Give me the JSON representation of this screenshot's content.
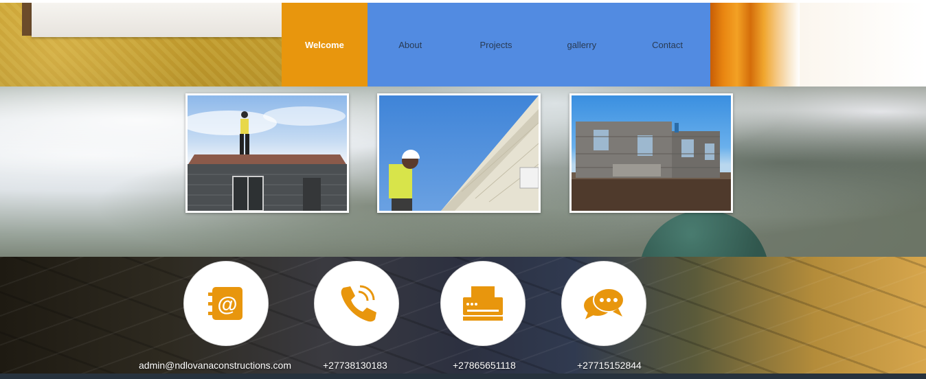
{
  "nav": {
    "items": [
      {
        "label": "Welcome",
        "active": true
      },
      {
        "label": "About"
      },
      {
        "label": "Projects"
      },
      {
        "label": "gallerry"
      },
      {
        "label": "Contact"
      }
    ],
    "active_color": "#e8960d",
    "bar_color": "#528be1"
  },
  "gallery": {
    "photos": [
      {
        "name": "worker-on-roof-photo"
      },
      {
        "name": "worker-siding-photo"
      },
      {
        "name": "house-construction-photo"
      }
    ]
  },
  "contact": {
    "icon_color": "#e8960d",
    "items": [
      {
        "icon": "email-icon",
        "label": "admin@ndlovanaconstructions.com"
      },
      {
        "icon": "phone-icon",
        "label": "+27738130183"
      },
      {
        "icon": "fax-icon",
        "label": "+27865651118"
      },
      {
        "icon": "chat-icon",
        "label": "+27715152844"
      }
    ]
  }
}
